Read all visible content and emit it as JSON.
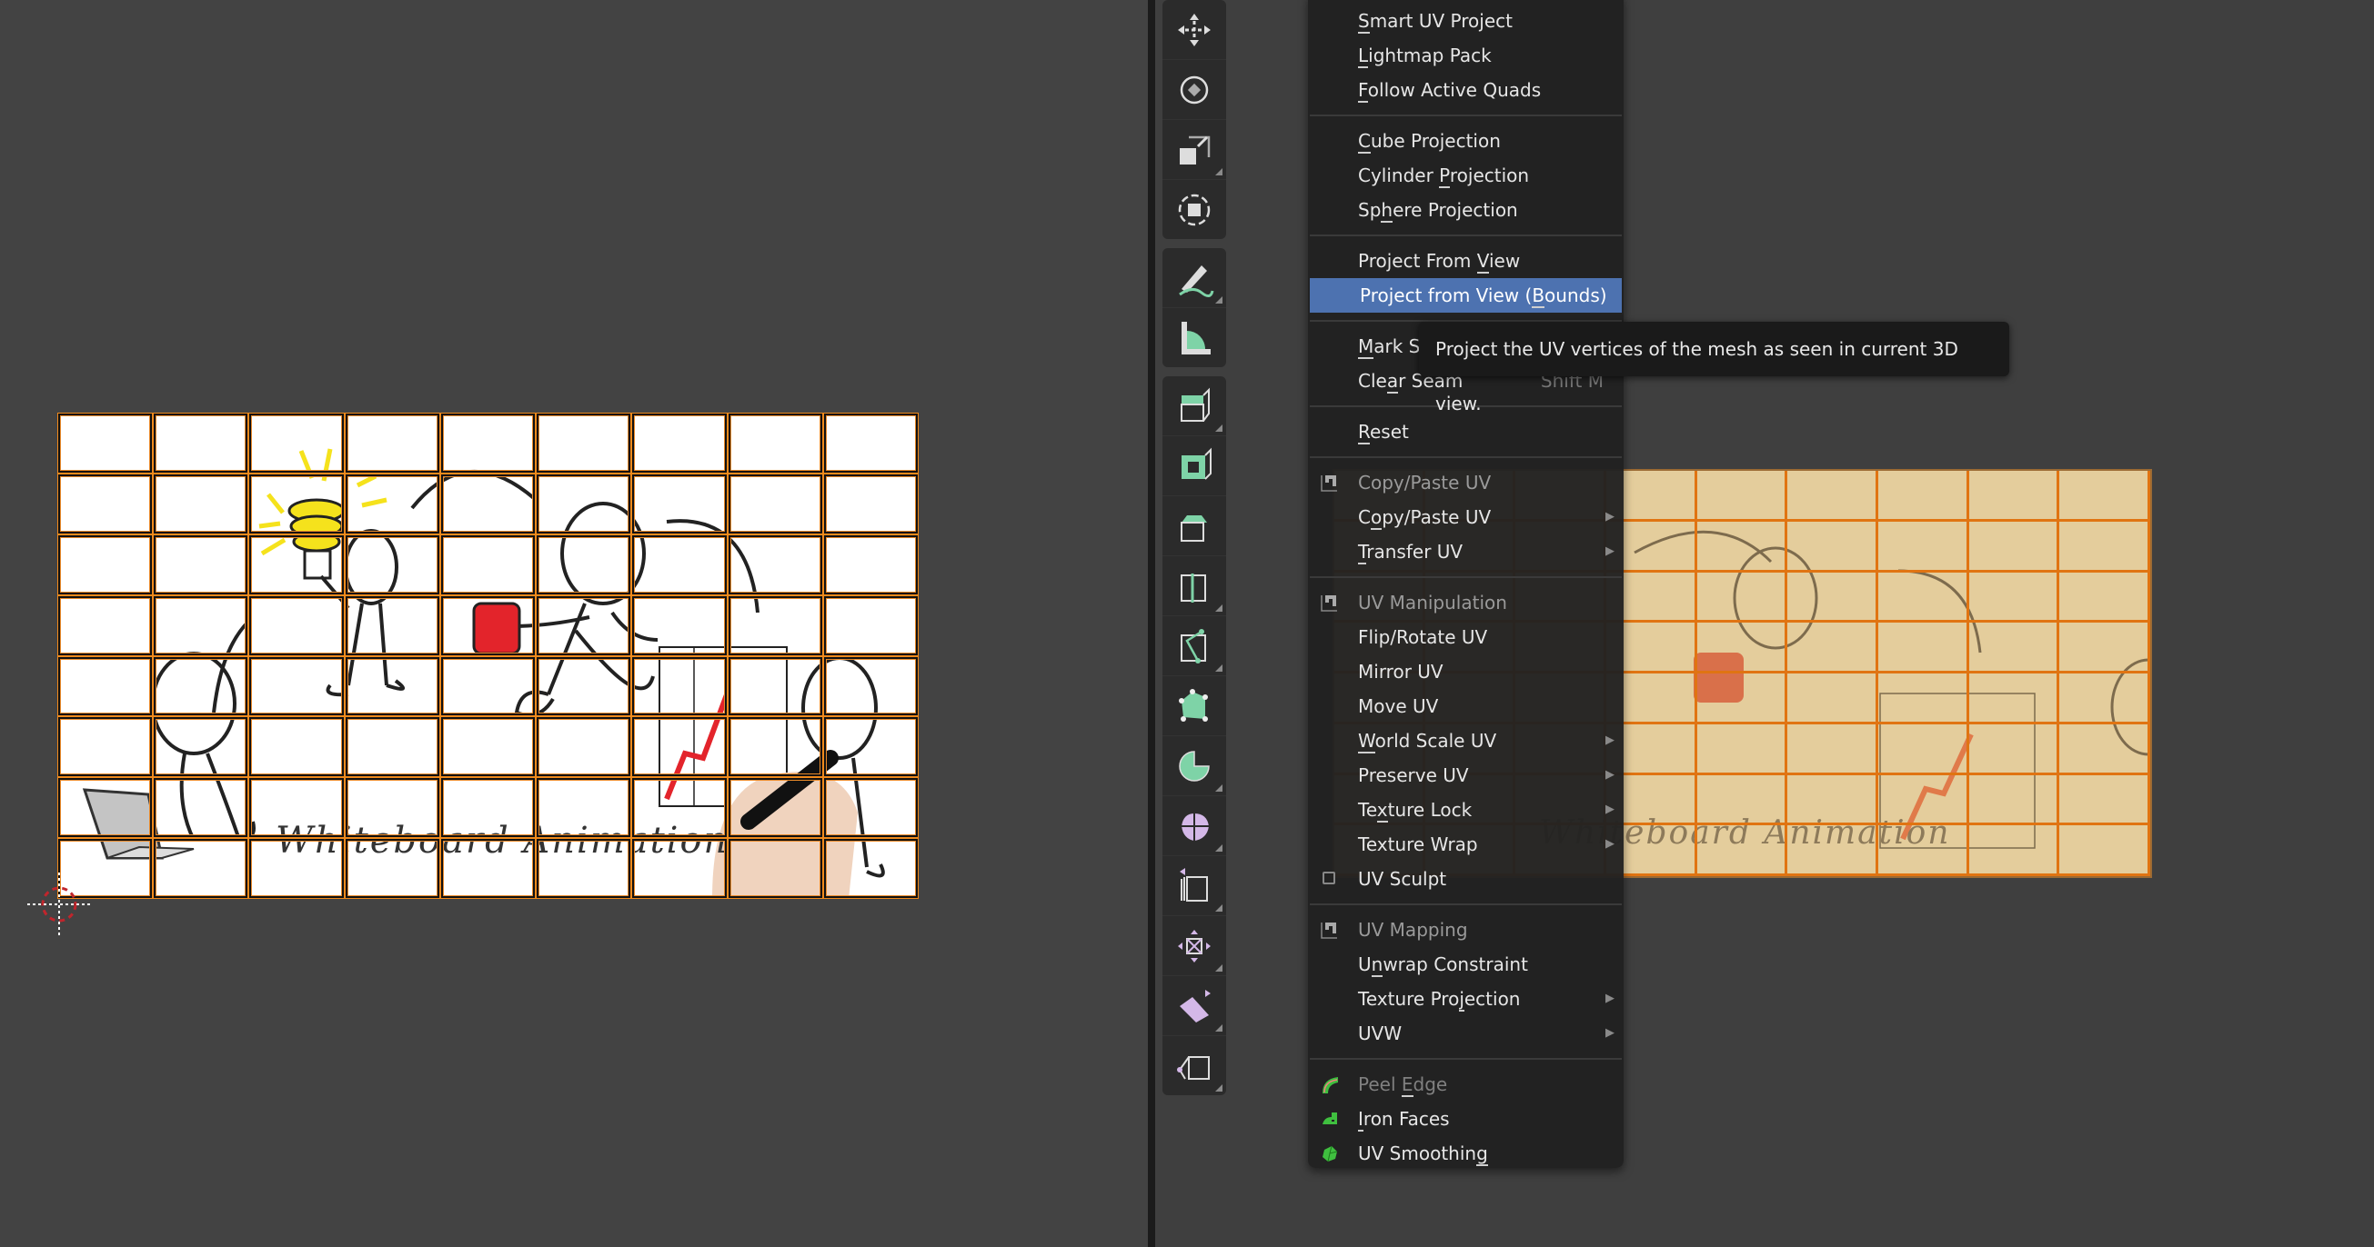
{
  "uv_editor": {
    "image_text": "Whiteboard Animation",
    "grid_columns": 9,
    "grid_rows": 8,
    "grid_color": "#f08a1c"
  },
  "toolbar": {
    "tools": [
      {
        "name": "move-tool",
        "icon": "move-icon",
        "has_submenu": false
      },
      {
        "name": "rotate-tool",
        "icon": "rotate-icon",
        "has_submenu": false
      },
      {
        "name": "scale-tool",
        "icon": "scale-icon",
        "has_submenu": true
      },
      {
        "name": "transform-tool",
        "icon": "transform-icon",
        "has_submenu": false
      },
      {
        "name": "annotate-tool",
        "icon": "annotate-icon",
        "has_submenu": true
      },
      {
        "name": "measure-tool",
        "icon": "measure-icon",
        "has_submenu": false
      },
      {
        "name": "extrude-region-tool",
        "icon": "extrude-icon",
        "has_submenu": true
      },
      {
        "name": "inset-faces-tool",
        "icon": "inset-icon",
        "has_submenu": false
      },
      {
        "name": "bevel-tool",
        "icon": "bevel-icon",
        "has_submenu": false
      },
      {
        "name": "loop-cut-tool",
        "icon": "loop-cut-icon",
        "has_submenu": true
      },
      {
        "name": "knife-tool",
        "icon": "knife-icon",
        "has_submenu": true
      },
      {
        "name": "poly-build-tool",
        "icon": "poly-build-icon",
        "has_submenu": false
      },
      {
        "name": "spin-tool",
        "icon": "spin-icon",
        "has_submenu": true
      },
      {
        "name": "smooth-tool",
        "icon": "smooth-icon",
        "has_submenu": true
      },
      {
        "name": "edge-slide-tool",
        "icon": "edge-slide-icon",
        "has_submenu": true
      },
      {
        "name": "shrink-fatten-tool",
        "icon": "shrink-fatten-icon",
        "has_submenu": true
      },
      {
        "name": "shear-tool",
        "icon": "shear-icon",
        "has_submenu": true
      },
      {
        "name": "rip-region-tool",
        "icon": "rip-icon",
        "has_submenu": true
      }
    ]
  },
  "menu": {
    "items": [
      {
        "label": "Smart UV Project",
        "type": "item"
      },
      {
        "label": "Lightmap Pack",
        "type": "item"
      },
      {
        "label": "Follow Active Quads",
        "type": "item"
      },
      {
        "type": "separator"
      },
      {
        "label": "Cube Projection",
        "type": "item"
      },
      {
        "label": "Cylinder Projection",
        "type": "item"
      },
      {
        "label": "Sphere Projection",
        "type": "item"
      },
      {
        "type": "separator"
      },
      {
        "label": "Project From View",
        "type": "item"
      },
      {
        "label": "Project from View (Bounds)",
        "type": "item",
        "active": true
      },
      {
        "type": "separator"
      },
      {
        "label": "Mark Seam",
        "type": "item",
        "shortcut": ""
      },
      {
        "label": "Clear Seam",
        "type": "item",
        "shortcut": "Shift M"
      },
      {
        "type": "separator"
      },
      {
        "label": "Reset",
        "type": "item"
      },
      {
        "type": "separator"
      },
      {
        "label": "Copy/Paste UV",
        "type": "header",
        "icon": "addon-icon"
      },
      {
        "label": "Copy/Paste UV",
        "type": "submenu"
      },
      {
        "label": "Transfer UV",
        "type": "submenu"
      },
      {
        "type": "separator"
      },
      {
        "label": "UV Manipulation",
        "type": "header",
        "icon": "addon-icon"
      },
      {
        "label": "Flip/Rotate UV",
        "type": "item"
      },
      {
        "label": "Mirror UV",
        "type": "item"
      },
      {
        "label": "Move UV",
        "type": "item"
      },
      {
        "label": "World Scale UV",
        "type": "submenu"
      },
      {
        "label": "Preserve UV",
        "type": "submenu"
      },
      {
        "label": "Texture Lock",
        "type": "submenu"
      },
      {
        "label": "Texture Wrap",
        "type": "submenu"
      },
      {
        "label": "UV Sculpt",
        "type": "checkbox",
        "checked": false
      },
      {
        "type": "separator"
      },
      {
        "label": "UV Mapping",
        "type": "header",
        "icon": "addon-icon"
      },
      {
        "label": "Unwrap Constraint",
        "type": "item"
      },
      {
        "label": "Texture Projection",
        "type": "submenu"
      },
      {
        "label": "UVW",
        "type": "submenu"
      },
      {
        "type": "separator"
      },
      {
        "label": "Peel Edge",
        "type": "disabled",
        "icon": "peel-edge-icon"
      },
      {
        "label": "Iron Faces",
        "type": "item",
        "icon": "iron-faces-icon"
      },
      {
        "label": "UV Smoothing",
        "type": "item",
        "icon": "uv-smoothing-icon"
      }
    ]
  },
  "tooltip": {
    "text": "Project the UV vertices of the mesh as seen in current 3D view."
  },
  "viewport": {
    "plane_text": "Whiteboard Animation"
  },
  "colors": {
    "menu_active": "#4d72b0",
    "grid_orange": "#f08a1c",
    "plane_tint": "#e4cd9c"
  }
}
